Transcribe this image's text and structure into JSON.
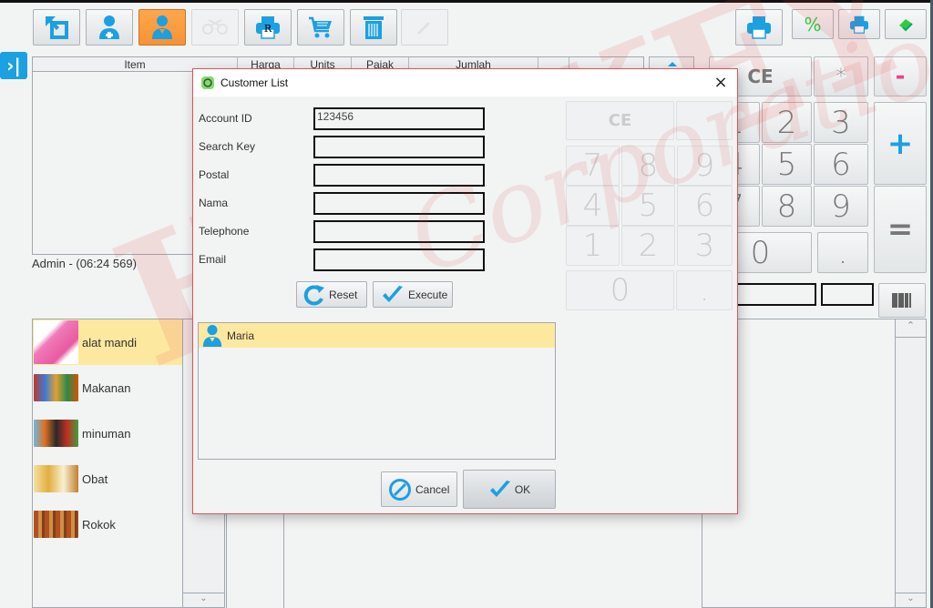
{
  "toolbar": {
    "buttons": [
      {
        "name": "menu-toggle",
        "icon": "expand-arrow-icon",
        "state": "normal"
      },
      {
        "name": "add-customer",
        "icon": "user-add-icon",
        "state": "normal"
      },
      {
        "name": "customer",
        "icon": "user-icon",
        "state": "active"
      },
      {
        "name": "split",
        "icon": "scissors-icon",
        "state": "disabled"
      },
      {
        "name": "reprint",
        "icon": "printer-r-icon",
        "state": "normal"
      },
      {
        "name": "cart",
        "icon": "cart-icon",
        "state": "normal"
      },
      {
        "name": "delete",
        "icon": "trash-icon",
        "state": "normal"
      },
      {
        "name": "edit",
        "icon": "pencil-icon",
        "state": "disabled"
      }
    ],
    "reprint_letter": "R",
    "right_buttons": [
      {
        "name": "print",
        "icon": "printer-icon"
      },
      {
        "name": "discount",
        "icon": "percent-icon",
        "label": "%"
      },
      {
        "name": "print-small",
        "icon": "printer-icon"
      },
      {
        "name": "eraser",
        "icon": "eraser-icon"
      }
    ]
  },
  "sidebar_toggle": {
    "label": "›|"
  },
  "ticket_table": {
    "columns": [
      "Item",
      "Harga",
      "Units",
      "Pajak",
      "Jumlah",
      ""
    ],
    "rows": []
  },
  "status_line": "Admin - (06:24 569)",
  "keypad": {
    "ce": "CE",
    "multiply": "*",
    "minus": "-",
    "plus": "+",
    "equals": "=",
    "digits": [
      "7",
      "8",
      "9",
      "4",
      "5",
      "6",
      "1",
      "2",
      "3",
      "0",
      "."
    ]
  },
  "categories": [
    {
      "label": "alat mandi",
      "selected": true
    },
    {
      "label": "Makanan",
      "selected": false
    },
    {
      "label": "minuman",
      "selected": false
    },
    {
      "label": "Obat",
      "selected": false
    },
    {
      "label": "Rokok",
      "selected": false
    }
  ],
  "dialog": {
    "title": "Customer List",
    "close_label": "×",
    "fields": [
      {
        "label": "Account ID",
        "value": "123456"
      },
      {
        "label": "Search Key",
        "value": ""
      },
      {
        "label": "Postal",
        "value": ""
      },
      {
        "label": "Nama",
        "value": ""
      },
      {
        "label": "Telephone",
        "value": ""
      },
      {
        "label": "Email",
        "value": ""
      }
    ],
    "reset_label": "Reset",
    "execute_label": "Execute",
    "results": [
      {
        "name": "Maria",
        "selected": true
      }
    ],
    "cancel_label": "Cancel",
    "ok_label": "OK"
  },
  "watermark": {
    "main": "HOCKEY",
    "sub": "Corporation"
  },
  "colors": {
    "accent": "#1ba0e2",
    "active_button": "#f79333",
    "selection": "#fde8a0",
    "dialog_border": "#e0525c",
    "minus": "#ee3f8a",
    "percent": "#2ecc40"
  }
}
